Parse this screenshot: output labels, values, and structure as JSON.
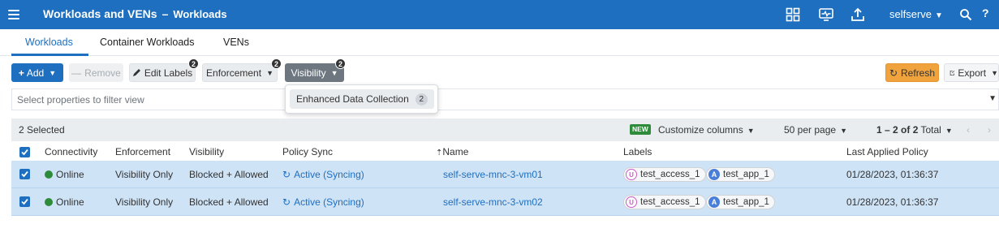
{
  "header": {
    "title": "Workloads and VENs",
    "separator": "–",
    "subtitle": "Workloads",
    "icons": [
      "dashboard-icon",
      "monitor-icon",
      "upload-icon",
      "search-icon",
      "help-icon"
    ],
    "user": "selfserve",
    "help_label": "?"
  },
  "tabs": [
    {
      "label": "Workloads",
      "active": true
    },
    {
      "label": "Container Workloads",
      "active": false
    },
    {
      "label": "VENs",
      "active": false
    }
  ],
  "toolbar": {
    "add_label": "Add",
    "remove_label": "Remove",
    "edit_labels_label": "Edit Labels",
    "edit_labels_badge": "2",
    "enforcement_label": "Enforcement",
    "enforcement_badge": "2",
    "visibility_label": "Visibility",
    "visibility_badge": "2",
    "refresh_label": "Refresh",
    "export_label": "Export"
  },
  "filter": {
    "placeholder": "Select properties to filter view"
  },
  "visibility_menu": {
    "item_label": "Enhanced Data Collection",
    "item_count": "2"
  },
  "selection_bar": {
    "selected_text": "2 Selected",
    "new_badge": "NEW",
    "customize_label": "Customize columns",
    "per_page_label": "50 per page",
    "range_prefix": "1 – 2 of ",
    "range_total": "2",
    "range_suffix": " Total"
  },
  "table": {
    "columns": [
      "Connectivity",
      "Enforcement",
      "Visibility",
      "Policy Sync",
      "Name",
      "Labels",
      "Last Applied Policy"
    ],
    "sort_indicator": "⇡",
    "rows": [
      {
        "connectivity": "Online",
        "enforcement": "Visibility Only",
        "visibility": "Blocked + Allowed",
        "policy_sync": "Active (Syncing)",
        "name": "self-serve-mnc-3-vm01",
        "labels": [
          {
            "icon": "U",
            "text": "test_access_1"
          },
          {
            "icon": "A",
            "text": "test_app_1"
          }
        ],
        "last_applied": "01/28/2023, 01:36:37"
      },
      {
        "connectivity": "Online",
        "enforcement": "Visibility Only",
        "visibility": "Blocked + Allowed",
        "policy_sync": "Active (Syncing)",
        "name": "self-serve-mnc-3-vm02",
        "labels": [
          {
            "icon": "U",
            "text": "test_access_1"
          },
          {
            "icon": "A",
            "text": "test_app_1"
          }
        ],
        "last_applied": "01/28/2023, 01:36:37"
      }
    ]
  },
  "colors": {
    "brand": "#1e6fbf",
    "refresh": "#f0a23c",
    "online": "#2e8b3a",
    "row_selected": "#cfe3f6"
  }
}
